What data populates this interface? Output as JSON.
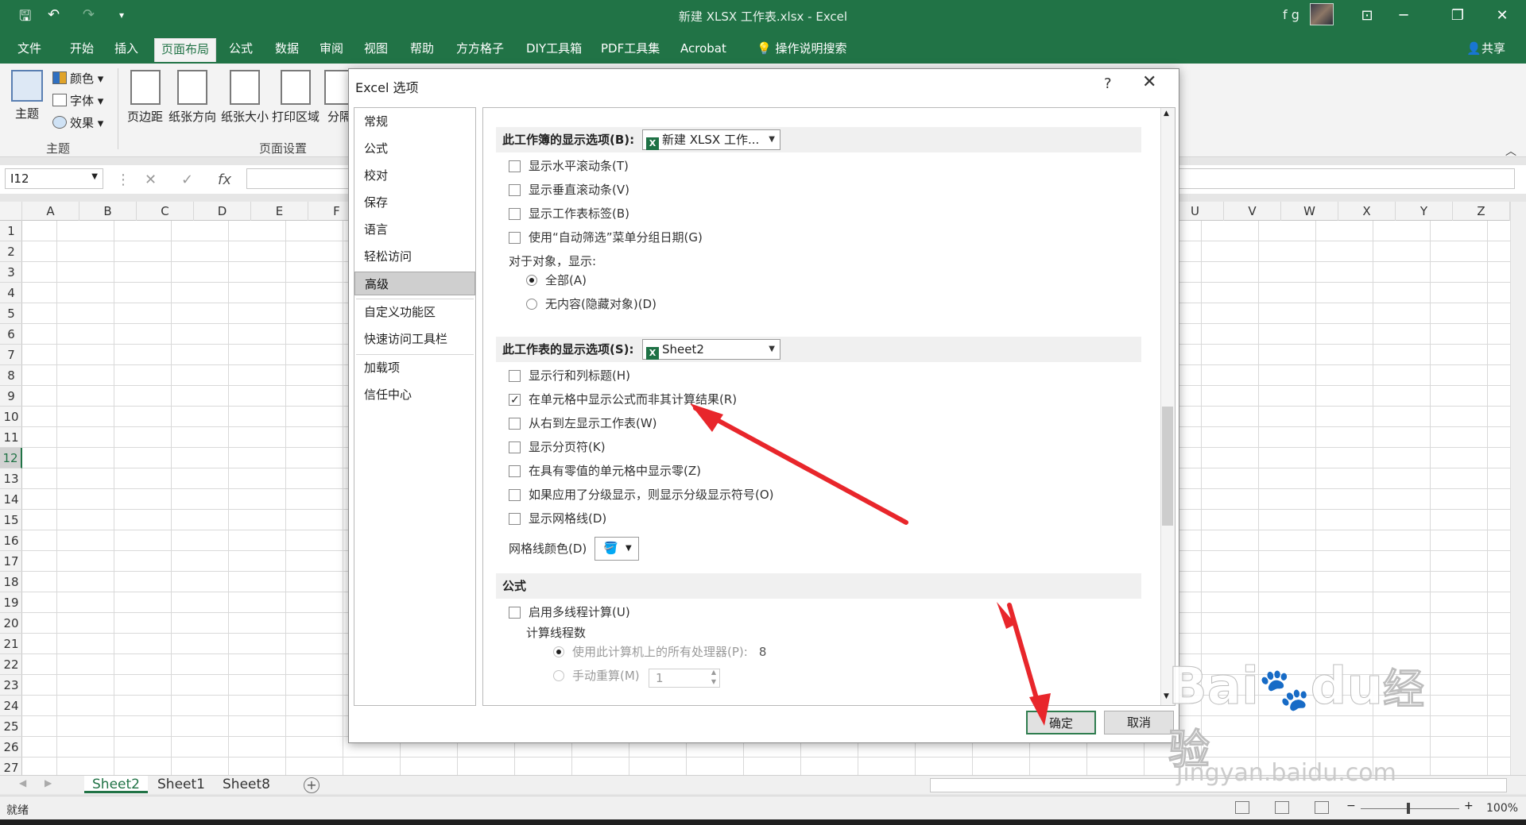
{
  "window": {
    "title": "新建 XLSX 工作表.xlsx  -  Excel",
    "user": "f g"
  },
  "tabs": [
    "文件",
    "开始",
    "插入",
    "页面布局",
    "公式",
    "数据",
    "审阅",
    "视图",
    "帮助",
    "方方格子",
    "DIY工具箱",
    "PDF工具集",
    "Acrobat",
    "操作说明搜索"
  ],
  "active_tab": "页面布局",
  "share_label": "共享",
  "ribbon": {
    "theme_label": "主题",
    "colors_label": "颜色",
    "fonts_label": "字体",
    "effects_label": "效果",
    "margins_label": "页边距",
    "orientation_label": "纸张方向",
    "size_label": "纸张大小",
    "print_area_label": "打印区域",
    "breaks_label": "分隔",
    "group_theme": "主题",
    "group_page_setup": "页面设置"
  },
  "formula_bar": {
    "name_box": "I12",
    "fx": "fx"
  },
  "columns_left": [
    "A",
    "B",
    "C",
    "D",
    "E",
    "F"
  ],
  "columns_right": [
    "U",
    "V",
    "W",
    "X",
    "Y",
    "Z"
  ],
  "rows": [
    "1",
    "2",
    "3",
    "4",
    "5",
    "6",
    "7",
    "8",
    "9",
    "10",
    "11",
    "12",
    "13",
    "14",
    "15",
    "16",
    "17",
    "18",
    "19",
    "20",
    "21",
    "22",
    "23",
    "24",
    "25",
    "26",
    "27"
  ],
  "selected_row": "12",
  "sheets": [
    "Sheet2",
    "Sheet1",
    "Sheet8"
  ],
  "active_sheet": "Sheet2",
  "status": {
    "ready": "就绪",
    "zoom": "100%"
  },
  "dialog": {
    "title": "Excel 选项",
    "help": "?",
    "nav": [
      "常规",
      "公式",
      "校对",
      "保存",
      "语言",
      "轻松访问",
      "高级",
      "自定义功能区",
      "快速访问工具栏",
      "加载项",
      "信任中心"
    ],
    "nav_active": "高级",
    "workbook_section": {
      "label": "此工作簿的显示选项(B):",
      "combo": "新建 XLSX 工作...",
      "options": [
        {
          "label": "显示水平滚动条(T)",
          "checked": false
        },
        {
          "label": "显示垂直滚动条(V)",
          "checked": false
        },
        {
          "label": "显示工作表标签(B)",
          "checked": false
        },
        {
          "label": "使用“自动筛选”菜单分组日期(G)",
          "checked": false
        }
      ],
      "objects_label": "对于对象，显示:",
      "radios": [
        {
          "label": "全部(A)",
          "checked": true
        },
        {
          "label": "无内容(隐藏对象)(D)",
          "checked": false
        }
      ]
    },
    "sheet_section": {
      "label": "此工作表的显示选项(S):",
      "combo": "Sheet2",
      "options": [
        {
          "label": "显示行和列标题(H)",
          "checked": false
        },
        {
          "label": "在单元格中显示公式而非其计算结果(R)",
          "checked": true
        },
        {
          "label": "从右到左显示工作表(W)",
          "checked": false
        },
        {
          "label": "显示分页符(K)",
          "checked": false
        },
        {
          "label": "在具有零值的单元格中显示零(Z)",
          "checked": false
        },
        {
          "label": "如果应用了分级显示，则显示分级显示符号(O)",
          "checked": false
        },
        {
          "label": "显示网格线(D)",
          "checked": false
        }
      ],
      "gridline_color_label": "网格线颜色(D)"
    },
    "formula_section": {
      "label": "公式",
      "multithread_label": "启用多线程计算(U)",
      "threads_label": "计算线程数",
      "all_processors_label": "使用此计算机上的所有处理器(P):",
      "all_processors_value": "8",
      "manual_label": "手动重算(M)",
      "manual_value": "1"
    },
    "ok_label": "确定",
    "cancel_label": "取消"
  },
  "watermark": {
    "brand": "Bai",
    "brand_suffix": "du",
    "cn": "经验",
    "url": "jingyan.baidu.com"
  },
  "colors": {
    "excel_green": "#217346",
    "arrow_red": "#e8262b"
  }
}
